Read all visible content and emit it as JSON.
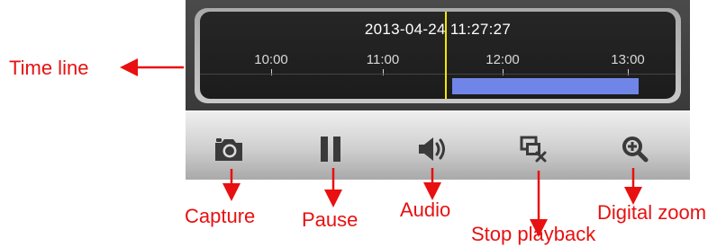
{
  "timeline": {
    "timestamp": "2013-04-24 11:27:27",
    "ticks": [
      "10:00",
      "11:00",
      "12:00",
      "13:00"
    ]
  },
  "toolbar": {
    "buttons": [
      {
        "icon": "camera-icon",
        "label": "Capture"
      },
      {
        "icon": "pause-icon",
        "label": "Pause"
      },
      {
        "icon": "speaker-icon",
        "label": "Audio"
      },
      {
        "icon": "stop-playback-icon",
        "label": "Stop playback"
      },
      {
        "icon": "zoom-in-icon",
        "label": "Digital zoom"
      }
    ]
  },
  "annotations": {
    "time_line": "Time line"
  },
  "colors": {
    "annotation": "#e81010",
    "playhead": "#f2e600",
    "recorded_segment": "#6f86e8"
  }
}
